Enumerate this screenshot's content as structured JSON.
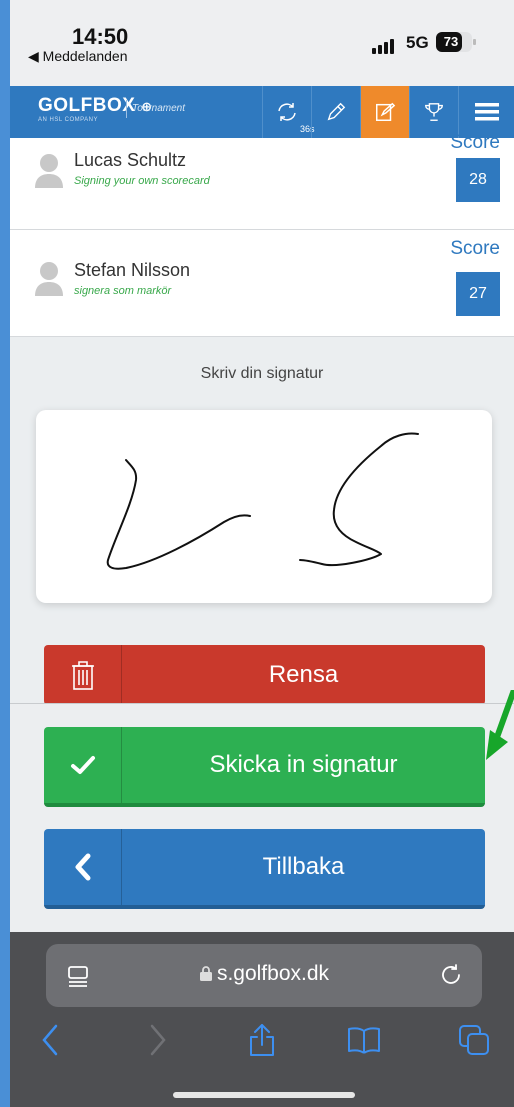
{
  "status_bar": {
    "time": "14:50",
    "back_app": "◀ Meddelanden",
    "network": "5G",
    "battery": "73",
    "battery_level": 0.73
  },
  "app_bar": {
    "logo": "GOLFBOX",
    "logo_sub": "AN HSL COMPANY",
    "section": "Tournament",
    "timer": "36s",
    "accent_color": "#2f79bf",
    "active_color": "#ef8a2b"
  },
  "players": [
    {
      "name": "Lucas Schultz",
      "subtitle": "Signing your own scorecard",
      "score_label": "Score",
      "score": "28"
    },
    {
      "name": "Stefan Nilsson",
      "subtitle": "signera som markör",
      "score_label": "Score",
      "score": "27"
    }
  ],
  "signature": {
    "title": "Skriv din signatur"
  },
  "buttons": {
    "clear": "Rensa",
    "submit": "Skicka in signatur",
    "back": "Tillbaka"
  },
  "browser": {
    "url": "s.golfbox.dk"
  }
}
